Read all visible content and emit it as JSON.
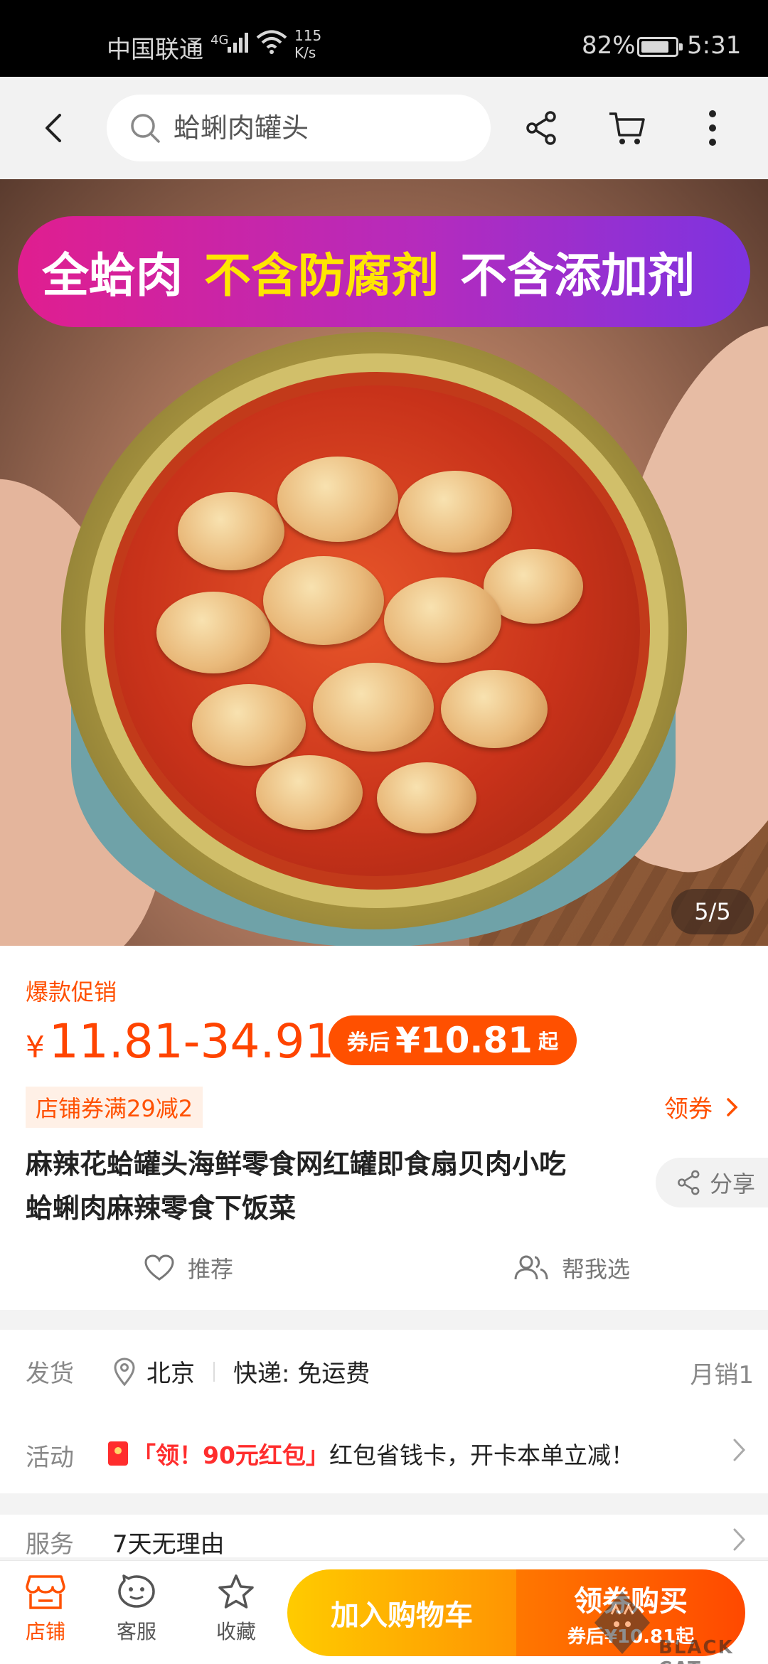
{
  "status_bar": {
    "carrier": "中国联通",
    "network": "4G",
    "speed_value": "115",
    "speed_unit": "K/s",
    "battery_percent": "82%",
    "battery_level": 0.82,
    "time": "5:31"
  },
  "top_nav": {
    "search_placeholder": "蛤蜊肉罐头",
    "icons": [
      "back-icon",
      "search-icon",
      "share-icon",
      "cart-icon",
      "more-icon"
    ]
  },
  "hero": {
    "banner_left": "全蛤肉",
    "banner_mid": "不含防腐剂",
    "banner_right": "不含添加剂",
    "counter": "5/5"
  },
  "product": {
    "promo_tag": "爆款促销",
    "currency": "¥",
    "price_range": "11.81-34.91",
    "coupon_label": "券后",
    "coupon_price": "¥10.81",
    "coupon_suffix": "起",
    "shop_coupon": "店铺券满29减2",
    "get_coupon": "领券",
    "title_line1": "麻辣花蛤罐头海鲜零食网红罐即食扇贝肉小吃",
    "title_line2": "蛤蜊肉麻辣零食下饭菜",
    "share": "分享",
    "recommend": "推荐",
    "help_choose": "帮我选"
  },
  "details": {
    "ship_label": "发货",
    "ship_city": "北京",
    "ship_express": "快递: 免运费",
    "monthly_sales": "月销1",
    "activity_label": "活动",
    "activity_highlight": "「领！90元红包」",
    "activity_text": "红包省钱卡，开卡本单立减！",
    "service_label": "服务",
    "service_value": "7天无理由"
  },
  "bottom_bar": {
    "shop": "店铺",
    "service": "客服",
    "favorite": "收藏",
    "add_to_cart": "加入购物车",
    "buy_main": "领券购买",
    "buy_sub": "券后¥10.81起"
  },
  "watermark": "BLACK CAT",
  "colors": {
    "accent": "#ff5000",
    "cart_button": "#ffb300",
    "buy_button": "#ff5a00"
  }
}
